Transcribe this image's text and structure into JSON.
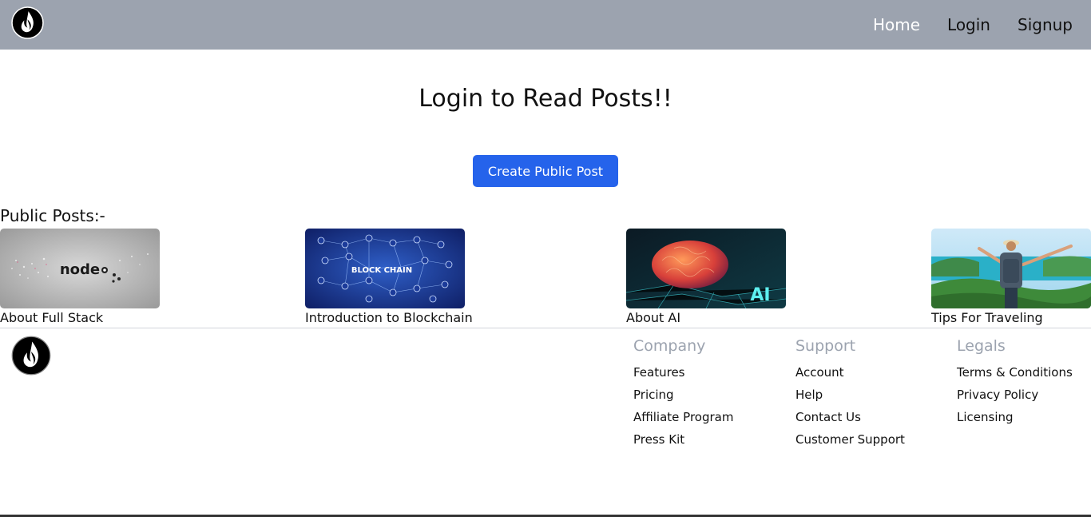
{
  "nav": {
    "logo": "flame-logo",
    "links": [
      "Home",
      "Login",
      "Signup"
    ]
  },
  "hero": {
    "title": "Login to Read Posts!!",
    "button": "Create Public Post"
  },
  "posts": {
    "heading": "Public Posts:-",
    "items": [
      {
        "title": "About Full Stack",
        "thumb_text": "node"
      },
      {
        "title": "Introduction to Blockchain",
        "thumb_text": "BLOCK CHAIN"
      },
      {
        "title": "About AI",
        "thumb_text": "AI"
      },
      {
        "title": "Tips For Traveling"
      }
    ]
  },
  "footer": {
    "columns": [
      {
        "heading": "Company",
        "links": [
          "Features",
          "Pricing",
          "Affiliate Program",
          "Press Kit"
        ]
      },
      {
        "heading": "Support",
        "links": [
          "Account",
          "Help",
          "Contact Us",
          "Customer Support"
        ]
      },
      {
        "heading": "Legals",
        "links": [
          "Terms & Conditions",
          "Privacy Policy",
          "Licensing"
        ]
      }
    ]
  },
  "colors": {
    "navbar_bg": "#9ca3af",
    "button_bg": "#2563eb",
    "footer_heading": "#9ca3af"
  }
}
